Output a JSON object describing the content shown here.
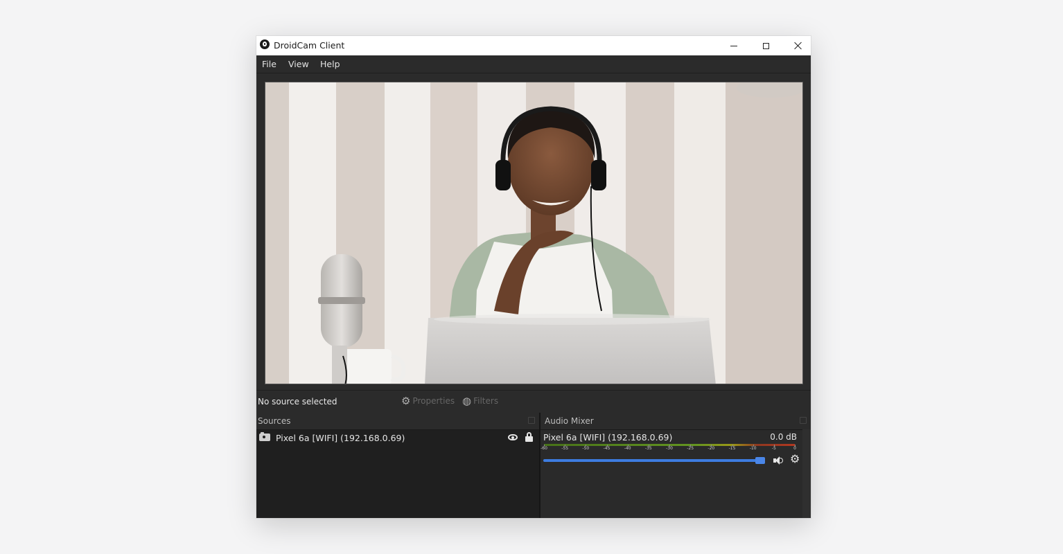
{
  "window": {
    "title": "DroidCam Client"
  },
  "menu": {
    "file": "File",
    "view": "View",
    "help": "Help"
  },
  "controls": {
    "status": "No source selected",
    "properties": "Properties",
    "filters": "Filters"
  },
  "sources": {
    "title": "Sources",
    "items": [
      {
        "label": "Pixel 6a [WIFI] (192.168.0.69)"
      }
    ]
  },
  "mixer": {
    "title": "Audio Mixer",
    "source_label": "Pixel 6a [WIFI] (192.168.0.69)",
    "db_value": "0.0 dB",
    "ticks": [
      "-60",
      "-55",
      "-50",
      "-45",
      "-40",
      "-35",
      "-30",
      "-25",
      "-20",
      "-15",
      "-10",
      "-5",
      "0"
    ],
    "volume_fraction": 1.0
  },
  "colors": {
    "accent": "#3d7ce0",
    "window_bg": "#2b2b2b",
    "dock_bg": "#1f1f1f"
  },
  "icons": [
    "app-icon",
    "minimize-icon",
    "maximize-icon",
    "close-icon",
    "gear-icon",
    "filters-icon",
    "camera-icon",
    "eye-icon",
    "lock-icon",
    "speaker-icon",
    "settings-gear-icon"
  ]
}
